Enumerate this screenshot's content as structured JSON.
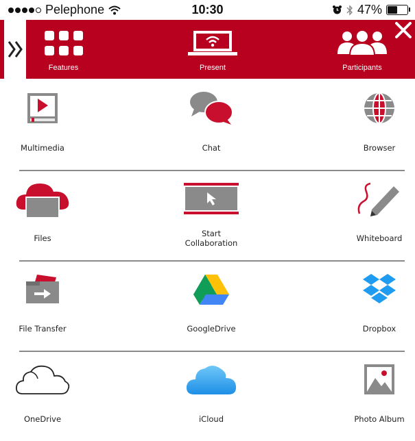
{
  "status_bar": {
    "carrier": "Pelephone",
    "time": "10:30",
    "battery": "47%"
  },
  "header": {
    "tabs": [
      {
        "label": "Features"
      },
      {
        "label": "Present"
      },
      {
        "label": "Participants"
      }
    ]
  },
  "grid": {
    "items": [
      {
        "label": "Multimedia"
      },
      {
        "label": "Chat"
      },
      {
        "label": "Browser"
      },
      {
        "label": "Files"
      },
      {
        "label": "Start Collaboration"
      },
      {
        "label": "Whiteboard"
      },
      {
        "label": "File Transfer"
      },
      {
        "label": "GoogleDrive"
      },
      {
        "label": "Dropbox"
      },
      {
        "label": "OneDrive"
      },
      {
        "label": "iCloud"
      },
      {
        "label": "Photo Album"
      }
    ]
  },
  "colors": {
    "brand": "#b8001f",
    "divider": "#8a8a8a"
  }
}
